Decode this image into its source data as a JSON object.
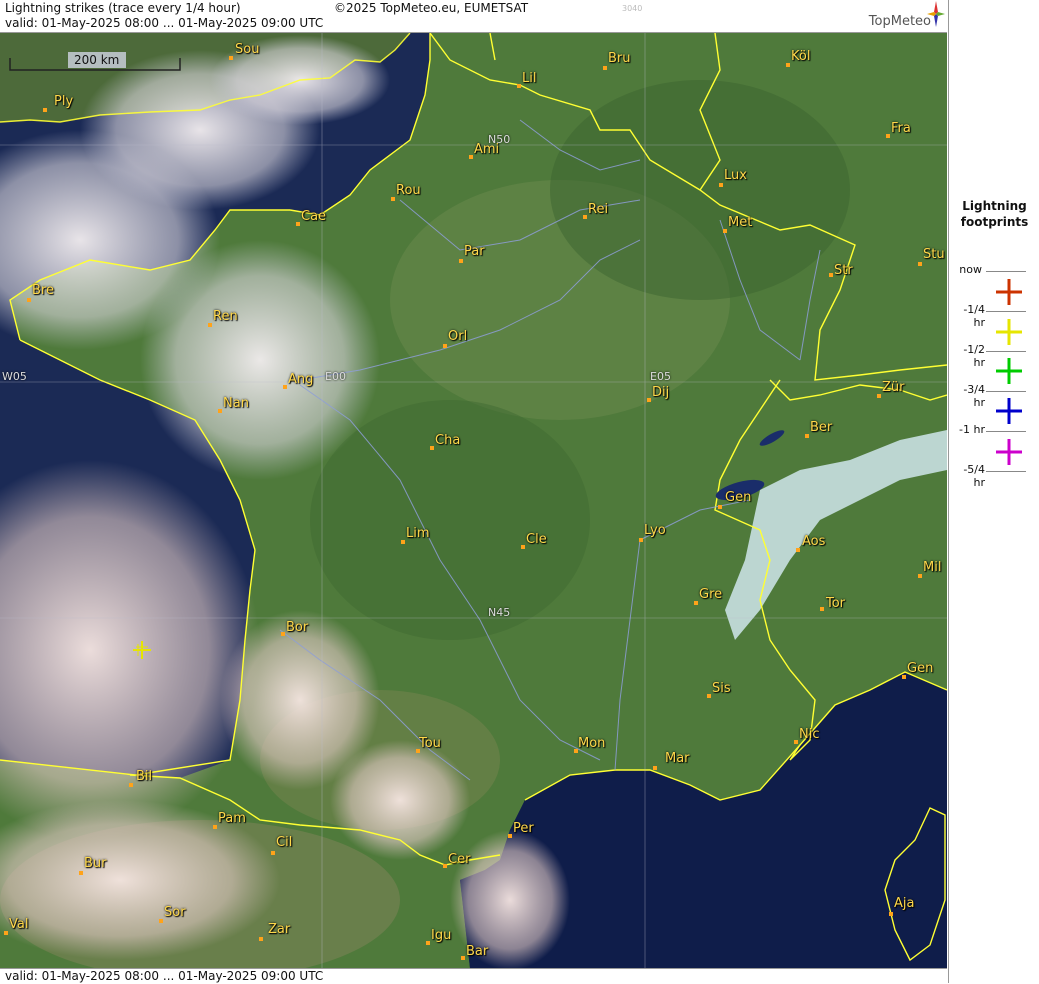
{
  "header": {
    "title": "Lightning strikes (trace every 1/4 hour)",
    "valid": "valid:  01-May-2025 08:00 ... 01-May-2025 09:00 UTC",
    "copyright": "©2025 TopMeteo.eu, EUMETSAT",
    "code": "3040",
    "brand": "TopMeteo"
  },
  "footer": {
    "valid": "valid:  01-May-2025 08:00 ... 01-May-2025 09:00 UTC"
  },
  "scale": {
    "label": "200 km"
  },
  "grid_labels": {
    "n50": "N50",
    "n45": "N45",
    "w05": "W05",
    "e00": "E00",
    "e05": "E05"
  },
  "cities": {
    "sou": "Sou",
    "ply": "Ply",
    "lil": "Lil",
    "bru": "Bru",
    "kol": "Köl",
    "ami": "Ami",
    "fra": "Fra",
    "rou": "Rou",
    "cae": "Cae",
    "rei": "Rei",
    "lux": "Lux",
    "met": "Met",
    "par": "Par",
    "stu": "Stu",
    "str": "Str",
    "bre": "Bre",
    "ren": "Ren",
    "orl": "Orl",
    "ang": "Ang",
    "nan": "Nan",
    "dij": "Dij",
    "zur": "Zür",
    "ber": "Ber",
    "cha": "Cha",
    "gen1": "Gen",
    "lim": "Lim",
    "cle": "Cle",
    "lyo": "Lyo",
    "aos": "Aos",
    "mil": "Mil",
    "gre": "Gre",
    "tor": "Tor",
    "bor": "Bor",
    "sis": "Sis",
    "gen2": "Gen",
    "tou": "Tou",
    "mon": "Mon",
    "mar": "Mar",
    "nic": "Nic",
    "bil": "Bil",
    "pam": "Pam",
    "per": "Per",
    "cil": "Cil",
    "cer": "Cer",
    "bur": "Bur",
    "aja": "Aja",
    "sor": "Sor",
    "val": "Val",
    "zar": "Zar",
    "igu": "Igu",
    "bar": "Bar"
  },
  "legend": {
    "title": "Lightning footprints",
    "entries": [
      {
        "label": "now",
        "color": "#cc3300"
      },
      {
        "label": "-1/4 hr",
        "color": "#e6e600"
      },
      {
        "label": "-1/2 hr",
        "color": "#00cc00"
      },
      {
        "label": "-3/4 hr",
        "color": "#0000cc"
      },
      {
        "label": "-1 hr",
        "color": "#cc00cc"
      },
      {
        "label": "-5/4 hr",
        "color": ""
      }
    ]
  },
  "strikes": [
    {
      "age": "-1/4 hr",
      "color": "#e6e600"
    }
  ]
}
